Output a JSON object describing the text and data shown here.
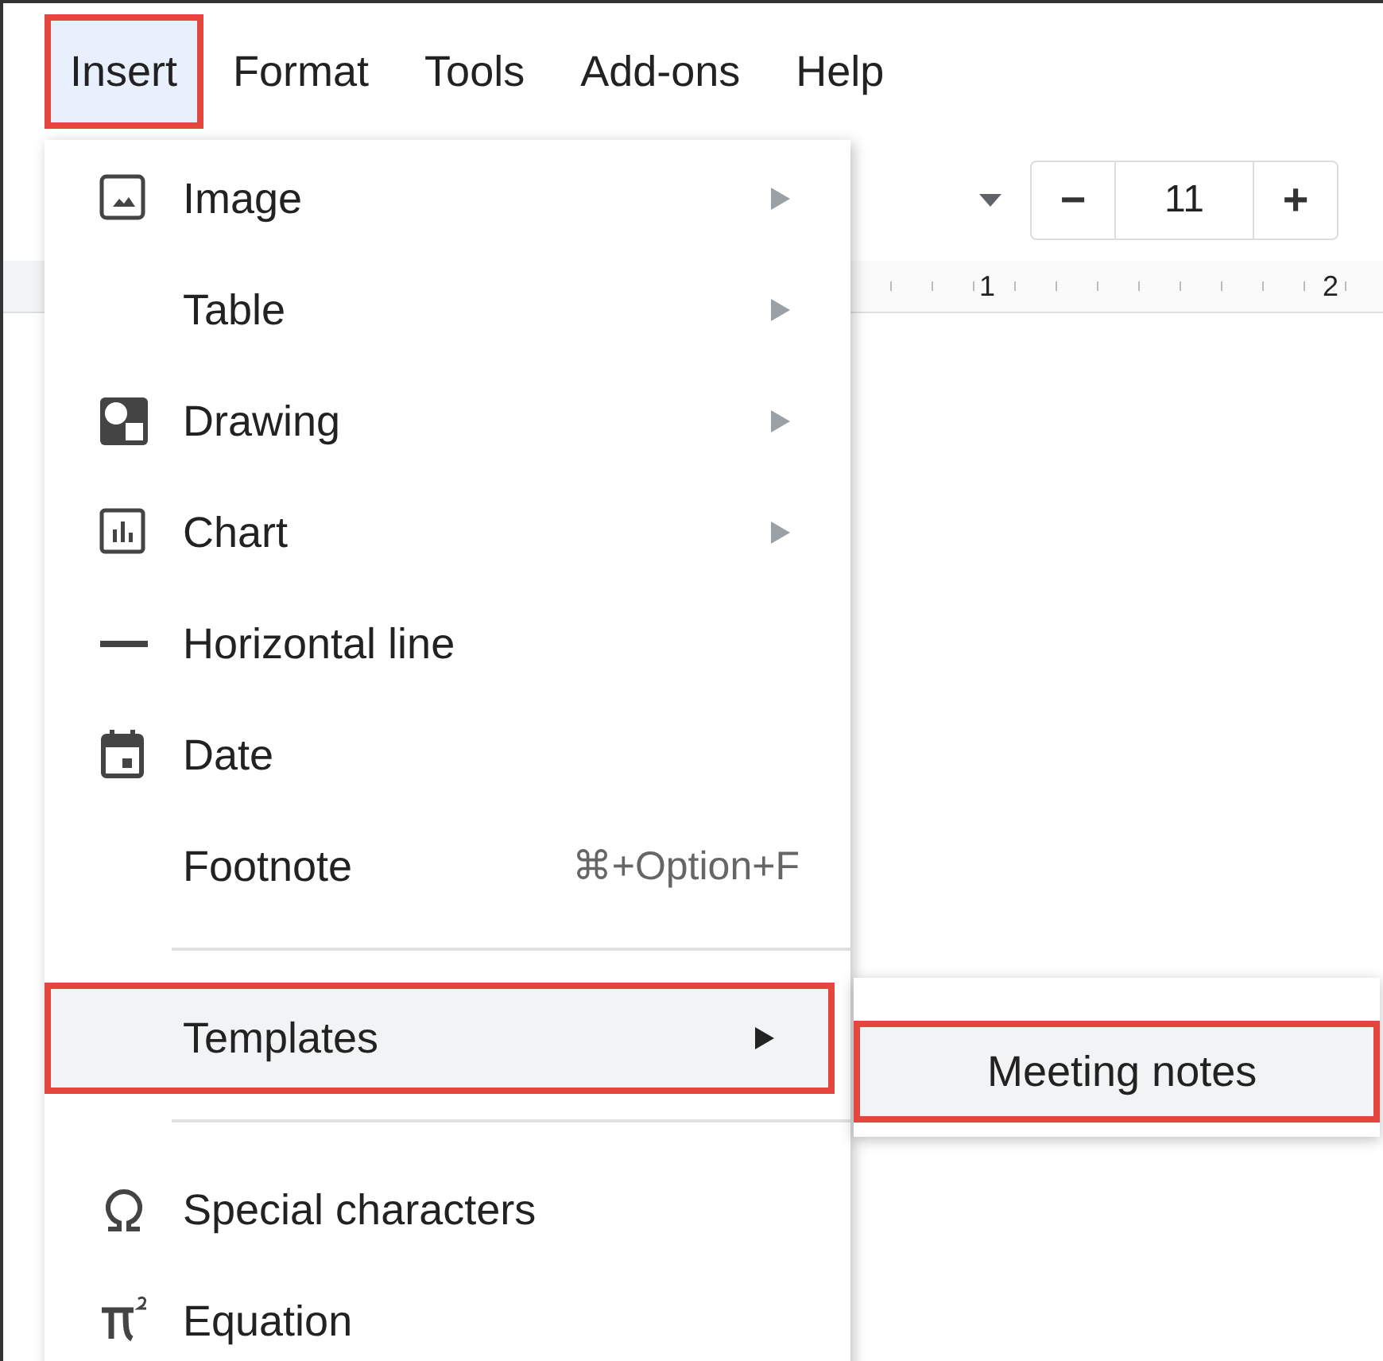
{
  "menubar": [
    {
      "label": "Insert",
      "selected": true
    },
    {
      "label": "Format",
      "selected": false
    },
    {
      "label": "Tools",
      "selected": false
    },
    {
      "label": "Add-ons",
      "selected": false
    },
    {
      "label": "Help",
      "selected": false
    }
  ],
  "toolbar": {
    "font_size": {
      "decrease": "−",
      "value": "11",
      "increase": "+"
    }
  },
  "ruler": {
    "numbers": [
      "1",
      "2"
    ]
  },
  "insert_menu": [
    {
      "kind": "item",
      "label": "Image",
      "submenu": true,
      "selected": false
    },
    {
      "kind": "item",
      "label": "Table",
      "submenu": true,
      "selected": false
    },
    {
      "kind": "item",
      "label": "Drawing",
      "submenu": true,
      "selected": false
    },
    {
      "kind": "item",
      "label": "Chart",
      "submenu": true,
      "selected": false
    },
    {
      "kind": "item",
      "label": "Horizontal line",
      "submenu": false,
      "selected": false
    },
    {
      "kind": "item",
      "label": "Date",
      "submenu": false,
      "selected": false
    },
    {
      "kind": "item",
      "label": "Footnote",
      "shortcut": "⌘+Option+F",
      "submenu": false,
      "selected": false
    },
    {
      "kind": "separator"
    },
    {
      "kind": "item",
      "label": "Templates",
      "submenu": true,
      "selected": true
    },
    {
      "kind": "separator"
    },
    {
      "kind": "item",
      "label": "Special characters",
      "submenu": false,
      "selected": false
    },
    {
      "kind": "item",
      "label": "Equation",
      "submenu": false,
      "selected": false
    }
  ],
  "templates_submenu": [
    {
      "label": "Meeting notes",
      "selected": true
    }
  ]
}
